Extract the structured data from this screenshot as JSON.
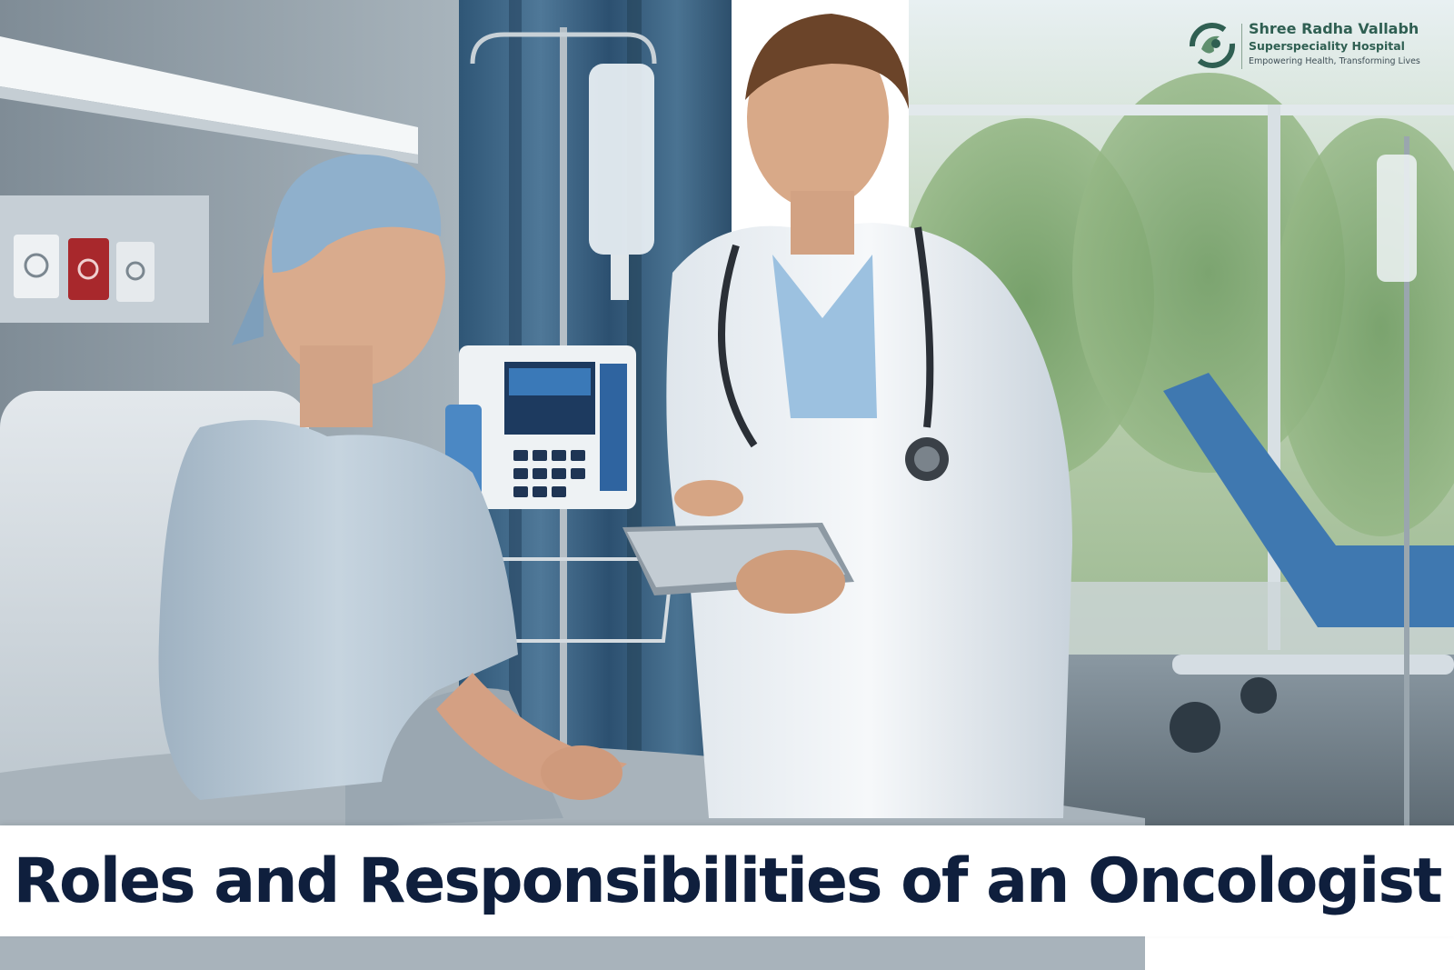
{
  "brand": {
    "name": "Shree Radha Vallabh",
    "subtitle": "Superspeciality Hospital",
    "tagline": "Empowering Health, Transforming Lives",
    "color": "#2f5f52"
  },
  "headline": {
    "text": "Roles and Responsibilities of an Oncologist",
    "color": "#0f1f3d"
  },
  "photo": {
    "icon": "hospital-room-photo"
  }
}
